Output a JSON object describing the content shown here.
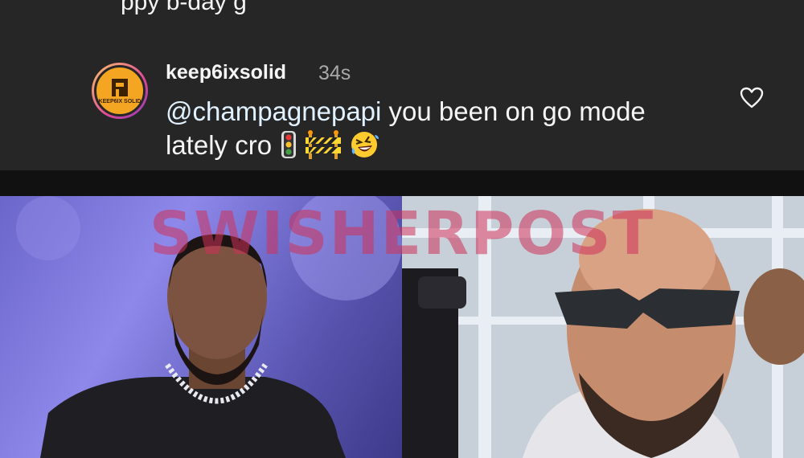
{
  "previous_comment": {
    "text_fragment": "ppy b-day g"
  },
  "comment": {
    "username": "keep6ixsolid",
    "timestamp": "34s",
    "mention": "@champagnepapi",
    "text": " you been on go mode lately cro",
    "avatar_caption": "KEEP6IX SOLID",
    "emojis": [
      "traffic-light-emoji",
      "construction-barrier-emoji",
      "rolling-laughing-emoji"
    ]
  },
  "watermark": {
    "text": "SWISHERPOST"
  },
  "colors": {
    "panel_bg": "#262626",
    "text": "#f5f5f5",
    "muted": "#a8a8a8",
    "mention": "#e0f1ff",
    "watermark": "#cd325a"
  }
}
